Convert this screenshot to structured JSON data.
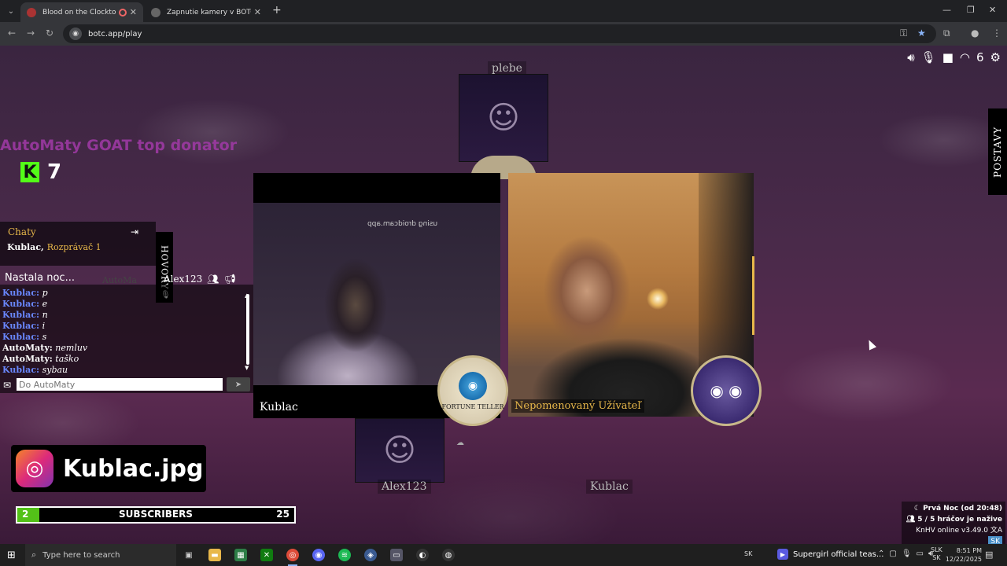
{
  "browser": {
    "tabs": [
      {
        "title": "Blood on the Clocktower O",
        "active": true
      },
      {
        "title": "Zapnutie kamery v BOTCT",
        "active": false
      }
    ],
    "new_tab": "+",
    "url": "botc.app/play"
  },
  "game": {
    "top_status_count": "6",
    "side_tab": "POSTAVY",
    "donor_text": "AutoMaty GOAT top donator",
    "kick_count": "7",
    "seats": {
      "top": "plebe",
      "bottom_left": "Alex123",
      "bottom_right": "Kublac"
    },
    "chat": {
      "title": "Chaty",
      "subtitle_name": "Kublac,",
      "subtitle_role": "Rozprávač 1",
      "calls_tab": "HOVORY",
      "night_notice": "Nastala noc...",
      "ghost_tab": "AutoMa",
      "call_user": "Alex123",
      "messages": [
        {
          "author": "Kublac:",
          "text": "p",
          "kind": "k"
        },
        {
          "author": "Kublac:",
          "text": "e",
          "kind": "k"
        },
        {
          "author": "Kublac:",
          "text": "n",
          "kind": "k"
        },
        {
          "author": "Kublac:",
          "text": "i",
          "kind": "k"
        },
        {
          "author": "Kublac:",
          "text": "s",
          "kind": "k"
        },
        {
          "author": "AutoMaty:",
          "text": "nemluv",
          "kind": "a"
        },
        {
          "author": "AutoMaty:",
          "text": "taško",
          "kind": "a"
        },
        {
          "author": "Kublac:",
          "text": "sybau",
          "kind": "k"
        }
      ],
      "input_placeholder": "Do AutoMaty"
    },
    "videos": [
      {
        "name": "Kublac",
        "watermark": "using droidcam.app"
      },
      {
        "name": "Nepomenovaný Užívateľ"
      }
    ],
    "tokens": {
      "left": "FORTUNE TELLER",
      "right_icon": "eyes-icon"
    }
  },
  "overlays": {
    "instagram": "Kublac.jpg",
    "subs": {
      "current": "2",
      "label": "SUBSCRIBERS",
      "goal": "25",
      "progress": 0.08
    }
  },
  "status": {
    "night": "Prvá Noc (od 20:48)",
    "players": "5 / 5 hráčov je nažive",
    "version": "KnHV online v3.49.0",
    "lang": "SK"
  },
  "taskbar": {
    "search_placeholder": "Type here to search",
    "lang": "SK",
    "media_title": "Supergirl official teas...",
    "kb_top": "SLK",
    "kb_bottom": "SK",
    "time": "8:51 PM",
    "date": "12/22/2025"
  },
  "colors": {
    "accent_gold": "#e8b84a",
    "kick_green": "#53fc18",
    "chat_blue": "#6a88ff"
  }
}
